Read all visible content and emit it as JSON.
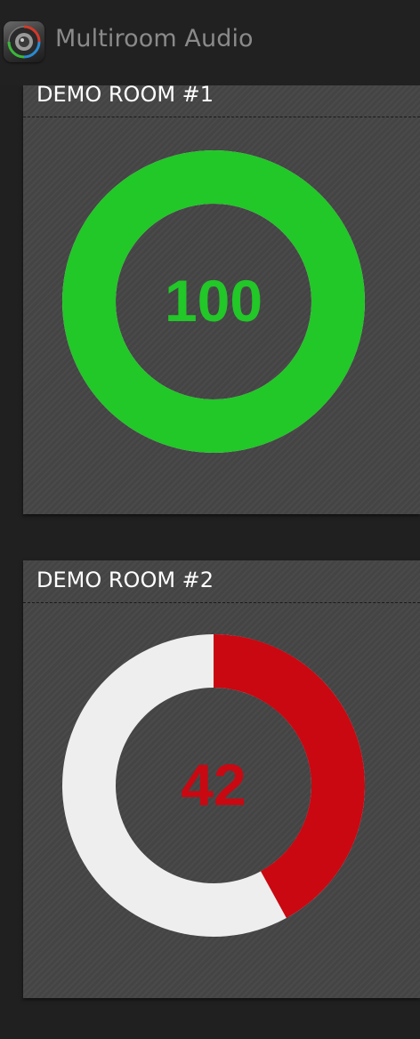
{
  "app": {
    "title": "Multiroom Audio",
    "icon": "speaker-icon"
  },
  "rooms": [
    {
      "name": "DEMO ROOM #1",
      "volume": 100,
      "volume_text": "100",
      "max": 100,
      "fill_color": "#22c728",
      "track_color": "#eeeeee",
      "text_color": "#22c728"
    },
    {
      "name": "DEMO ROOM #2",
      "volume": 42,
      "volume_text": "42",
      "max": 100,
      "fill_color": "#c90812",
      "track_color": "#eeeeee",
      "text_color": "#c90812"
    }
  ]
}
